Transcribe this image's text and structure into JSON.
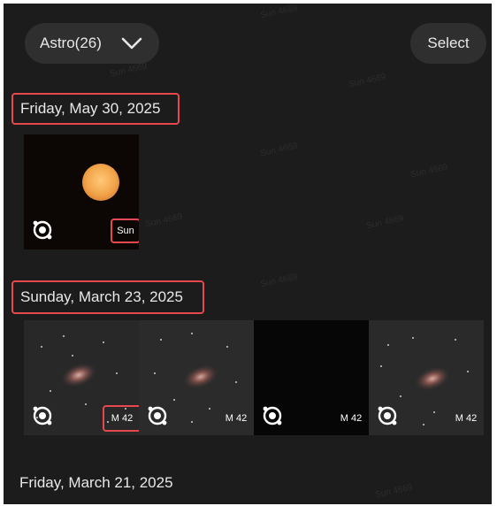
{
  "header": {
    "album_label": "Astro(26)",
    "select_label": "Select"
  },
  "sections": [
    {
      "date": "Friday, May 30, 2025",
      "photos": [
        {
          "label": "Sun"
        }
      ]
    },
    {
      "date": "Sunday, March 23, 2025",
      "photos": [
        {
          "label": "M 42"
        },
        {
          "label": "M 42"
        },
        {
          "label": "M 42"
        },
        {
          "label": "M 42"
        }
      ]
    },
    {
      "date": "Friday, March 21, 2025",
      "photos": []
    }
  ],
  "watermark": "Sun 4669",
  "colors": {
    "background": "#1c1c1c",
    "pill": "#2f2f2f",
    "highlight": "#e5484d",
    "sun": "#f2a54a"
  }
}
